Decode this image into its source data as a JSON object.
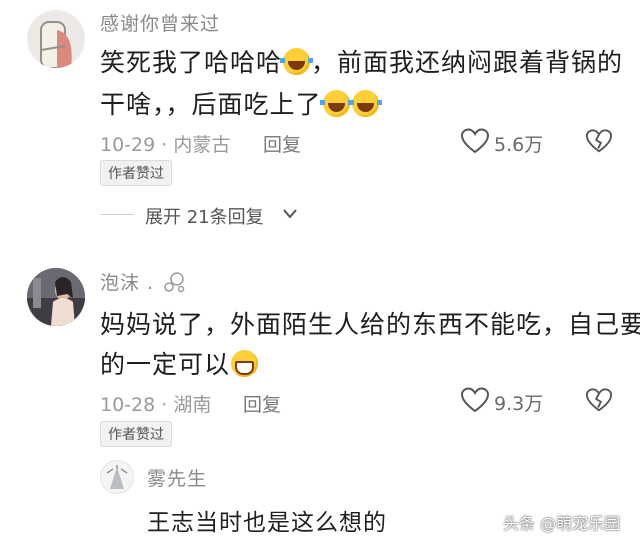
{
  "comments": [
    {
      "user": "感谢你曾来过",
      "line1": "笑死我了哈哈哈",
      "line1_tail": "，前面我还纳闷跟着背锅的",
      "line2": "干啥，，后面吃上了",
      "date": "10-29",
      "location": "内蒙古",
      "reply_label": "回复",
      "likes": "5.6万",
      "author_tag": "作者赞过",
      "expand_label": "展开 21条回复"
    },
    {
      "user": "泡沫 .",
      "line1": "妈妈说了，外面陌生人给的东西不能吃，自己要",
      "line2": "的一定可以",
      "date": "10-28",
      "location": "湖南",
      "reply_label": "回复",
      "likes": "9.3万",
      "author_tag": "作者赞过"
    }
  ],
  "reply": {
    "user": "雾先生",
    "text": "王志当时也是这么想的"
  },
  "watermark": "头条 @萌宠乐园",
  "emojis": [
    "laugh-cry-emoji",
    "grin-emoji"
  ],
  "colors": {
    "accent_emoji": "#ffcf3a",
    "tag_bg": "#f1f1f1",
    "text": "#1f1f1f",
    "meta": "#9a9a9a"
  }
}
